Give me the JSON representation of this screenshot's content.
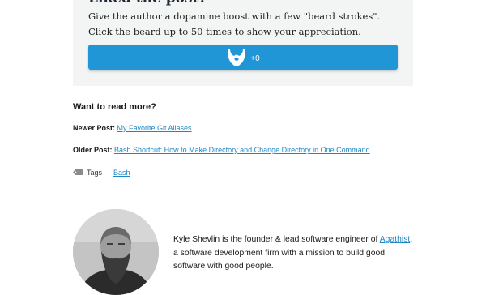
{
  "panel": {
    "title": "Liked the post?",
    "description": "Give the author a dopamine boost with a few \"beard strokes\". Click the beard up to 50 times to show your appreciation.",
    "beard_count": "+0",
    "button_color": "#2196d7"
  },
  "more": {
    "heading": "Want to read more?",
    "newer_label": "Newer Post:",
    "newer_link": "My Favorite Git Aliases",
    "older_label": "Older Post:",
    "older_link": "Bash Shortcut: How to Make Directory and Change Directory in One Command",
    "tags_label": "Tags",
    "tags": [
      "Bash"
    ],
    "link_color": "#1e88c7"
  },
  "bio": {
    "before": "Kyle Shevlin is the founder & lead software engineer of ",
    "link": "Agathist",
    "after": ", a software development firm with a mission to build good software with good people."
  },
  "icons": {
    "beard": "beard-icon",
    "tag": "tag-icon"
  }
}
